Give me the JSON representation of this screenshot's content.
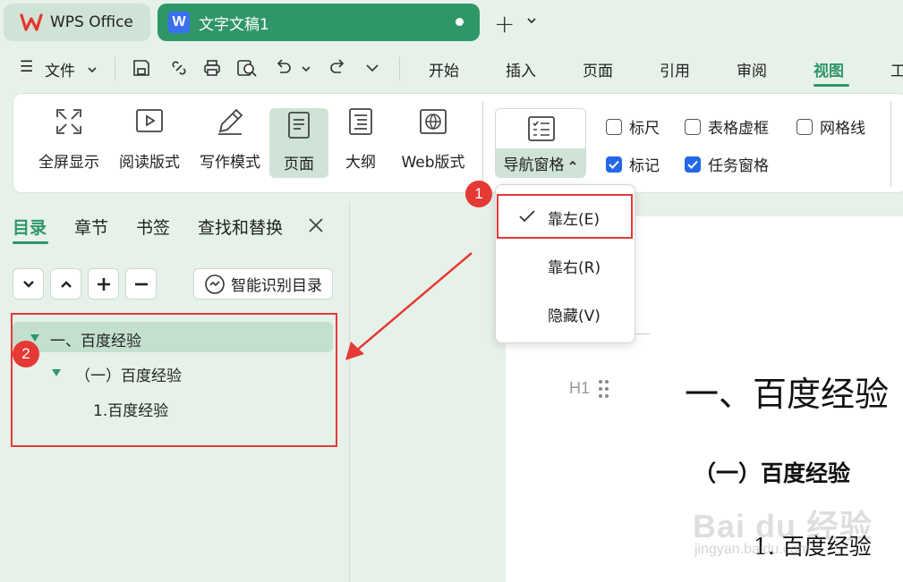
{
  "titlebar": {
    "wps_tab_label": "WPS Office",
    "doc_tab_label": "文字文稿1",
    "doc_tab_icon_letter": "W"
  },
  "menu": {
    "file_label": "文件",
    "tabs": [
      "开始",
      "插入",
      "页面",
      "引用",
      "审阅",
      "视图",
      "工"
    ],
    "active_tab": "视图"
  },
  "ribbon": {
    "buttons": [
      "全屏显示",
      "阅读版式",
      "写作模式",
      "页面",
      "大纲",
      "Web版式"
    ],
    "active_button": "页面",
    "nav_pane_label": "导航窗格",
    "checkboxes": [
      {
        "label": "标尺",
        "checked": false
      },
      {
        "label": "表格虚框",
        "checked": false
      },
      {
        "label": "网格线",
        "checked": false
      },
      {
        "label": "标记",
        "checked": true
      },
      {
        "label": "任务窗格",
        "checked": true
      }
    ]
  },
  "dropdown": {
    "items": [
      "靠左(E)",
      "靠右(R)",
      "隐藏(V)"
    ],
    "selected": "靠左(E)"
  },
  "nav_panel": {
    "tabs": [
      "目录",
      "章节",
      "书签",
      "查找和替换"
    ],
    "active_tab": "目录",
    "smart_button_label": "智能识别目录",
    "toc": [
      {
        "level": 1,
        "text": "一、百度经验"
      },
      {
        "level": 2,
        "text": "（一）百度经验"
      },
      {
        "level": 3,
        "text": "1.百度经验"
      }
    ]
  },
  "document": {
    "heading1": "一、百度经验",
    "heading2": "（一）百度经验",
    "heading3": "1. 百度经验",
    "h1_marker": "H1"
  },
  "annotations": {
    "badge1": "1",
    "badge2": "2"
  },
  "watermark": {
    "line1": "Bai du 经验",
    "line2": "jingyan.baidu.com"
  },
  "colors": {
    "accent": "#2f9668",
    "background": "#e6f1e9",
    "annotation_red": "#e53935",
    "checkbox_blue": "#2468e6"
  }
}
